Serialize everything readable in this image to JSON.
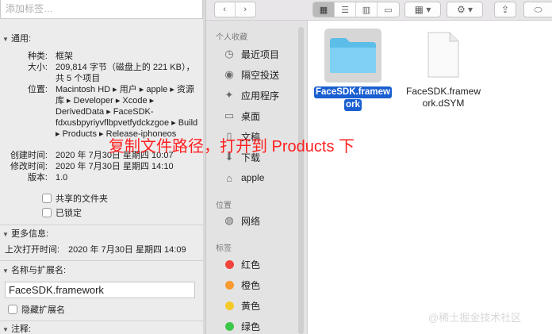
{
  "info": {
    "tags_placeholder": "添加标签…",
    "general": {
      "title": "通用:",
      "kind_label": "种类:",
      "kind_value": "框架",
      "size_label": "大小:",
      "size_value": "209,814 字节（磁盘上的 221 KB），共 5 个项目",
      "where_label": "位置:",
      "where_value": "Macintosh HD ▸ 用户 ▸ apple ▸ 资源库 ▸ Developer ▸ Xcode ▸ DerivedData ▸ FaceSDK-fdxusbpyriyvflbpvetfydckzgoe ▸ Build ▸ Products ▸ Release-iphoneos",
      "created_label": "创建时间:",
      "created_value": "2020 年 7月30日 星期四 10:07",
      "modified_label": "修改时间:",
      "modified_value": "2020 年 7月30日 星期四 14:10",
      "version_label": "版本:",
      "version_value": "1.0",
      "shared_folder": "共享的文件夹",
      "locked": "已锁定"
    },
    "more_info": {
      "title": "更多信息:",
      "last_opened_label": "上次打开时间:",
      "last_opened_value": "2020 年 7月30日 星期四 14:09"
    },
    "name_ext": {
      "title": "名称与扩展名:",
      "name_value": "FaceSDK.framework",
      "hide_ext": "隐藏扩展名"
    },
    "comments": {
      "title": "注释:"
    }
  },
  "sidebar": {
    "favorites_header": "个人收藏",
    "favorites": [
      {
        "label": "最近项目",
        "icon": "clock-icon"
      },
      {
        "label": "隔空投送",
        "icon": "airdrop-icon"
      },
      {
        "label": "应用程序",
        "icon": "apps-icon"
      },
      {
        "label": "桌面",
        "icon": "desktop-icon"
      },
      {
        "label": "文稿",
        "icon": "document-icon"
      },
      {
        "label": "下载",
        "icon": "download-icon"
      },
      {
        "label": "apple",
        "icon": "home-icon"
      }
    ],
    "locations_header": "位置",
    "locations": [
      {
        "label": "网络",
        "icon": "globe-icon"
      }
    ],
    "tags_header": "标签",
    "tags": [
      {
        "label": "红色",
        "color": "#f2443c"
      },
      {
        "label": "橙色",
        "color": "#f79a2f"
      },
      {
        "label": "黄色",
        "color": "#f5c927"
      },
      {
        "label": "绿色",
        "color": "#3dc84b"
      }
    ]
  },
  "files": [
    {
      "name": "FaceSDK.framework",
      "line1": "FaceSDK.framew",
      "line2": "ork",
      "type": "folder",
      "selected": true
    },
    {
      "name": "FaceSDK.framework.dSYM",
      "line1": "FaceSDK.framew",
      "line2": "ork.dSYM",
      "type": "document",
      "selected": false
    }
  ],
  "annotation": "复制文件路径，打开到 Products 下",
  "watermark": "@稀土掘金技术社区"
}
